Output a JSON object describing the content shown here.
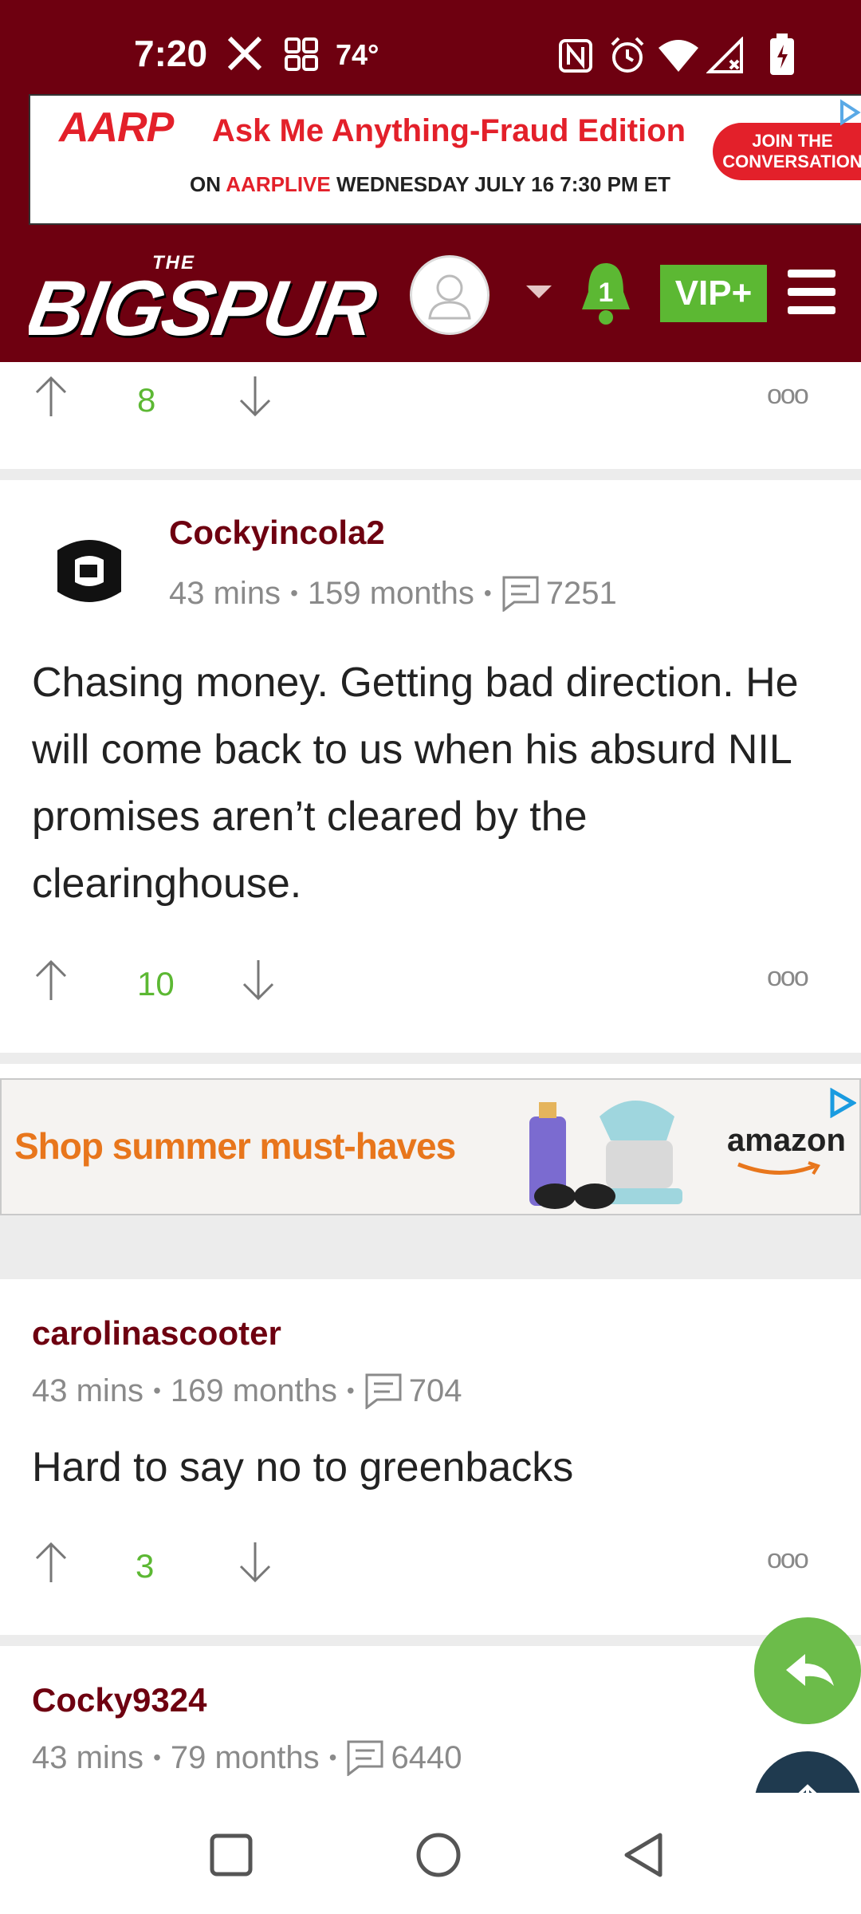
{
  "status_bar": {
    "time": "7:20",
    "temperature": "74°"
  },
  "ad_banner": {
    "brand": "AARP",
    "headline": "Ask Me Anything-Fraud Edition",
    "sub_prefix": "ON ",
    "sub_brand": "AARPLIVE",
    "sub_rest": " WEDNESDAY JULY 16 7:30 PM ET",
    "cta_line1": "JOIN THE",
    "cta_line2": "CONVERSATION"
  },
  "header": {
    "logo_small": "THE",
    "logo_main": "BIGSPUR",
    "notification_count": "1",
    "vip_label": "VIP+"
  },
  "comments": [
    {
      "vote_count": "8"
    },
    {
      "username": "Cockyincola2",
      "time": "43 mins",
      "tenure": "159 months",
      "post_count": "7251",
      "body": "Chasing money. Getting bad direction. He will come back to us when his absurd NIL promises aren’t cleared by the clearinghouse.",
      "vote_count": "10"
    },
    {
      "username": "carolinascooter",
      "time": "43 mins",
      "tenure": "169 months",
      "post_count": "704",
      "body": "Hard to say no to greenbacks",
      "vote_count": "3"
    },
    {
      "username": "Cocky9324",
      "time": "43 mins",
      "tenure": "79 months",
      "post_count": "6440"
    }
  ],
  "amazon_ad": {
    "text": "Shop summer must-haves",
    "brand": "amazon"
  },
  "more_label": "ooo",
  "colors": {
    "garnet": "#6e0010",
    "green": "#5cb833",
    "aarp_red": "#e3202a",
    "amazon_orange": "#e8761c"
  }
}
